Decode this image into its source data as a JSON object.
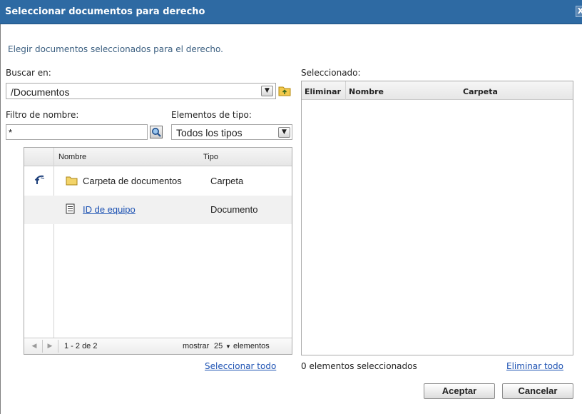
{
  "dialog": {
    "title": "Seleccionar documentos para derecho",
    "close_glyph": "X",
    "intro": "Elegir documentos seleccionados para el derecho."
  },
  "search_in": {
    "label": "Buscar en:",
    "value": "/Documentos",
    "folder_up_icon": "folder-up-icon"
  },
  "name_filter": {
    "label": "Filtro de nombre:",
    "value": "*"
  },
  "type_filter": {
    "label": "Elementos de tipo:",
    "value": "Todos los tipos"
  },
  "browser": {
    "columns": {
      "name": "Nombre",
      "type": "Tipo"
    },
    "rows": [
      {
        "name": "Carpeta de documentos",
        "type": "Carpeta",
        "icon": "folder-icon",
        "row_icon": "go-up-arrow-icon"
      },
      {
        "name": "ID de equipo",
        "type": "Documento",
        "icon": "document-icon"
      }
    ],
    "pager": {
      "range": "1 - 2 de 2",
      "show_label": "mostrar",
      "page_size": "25",
      "items_label": "elementos"
    },
    "select_all": "Seleccionar todo"
  },
  "selected": {
    "label": "Seleccionado:",
    "columns": {
      "remove": "Eliminar",
      "name": "Nombre",
      "folder": "Carpeta"
    },
    "count_text": "0 elementos seleccionados",
    "remove_all": "Eliminar todo"
  },
  "buttons": {
    "ok": "Aceptar",
    "cancel": "Cancelar"
  },
  "colors": {
    "title_bar": "#2e6aa3",
    "link": "#1d52b3"
  }
}
